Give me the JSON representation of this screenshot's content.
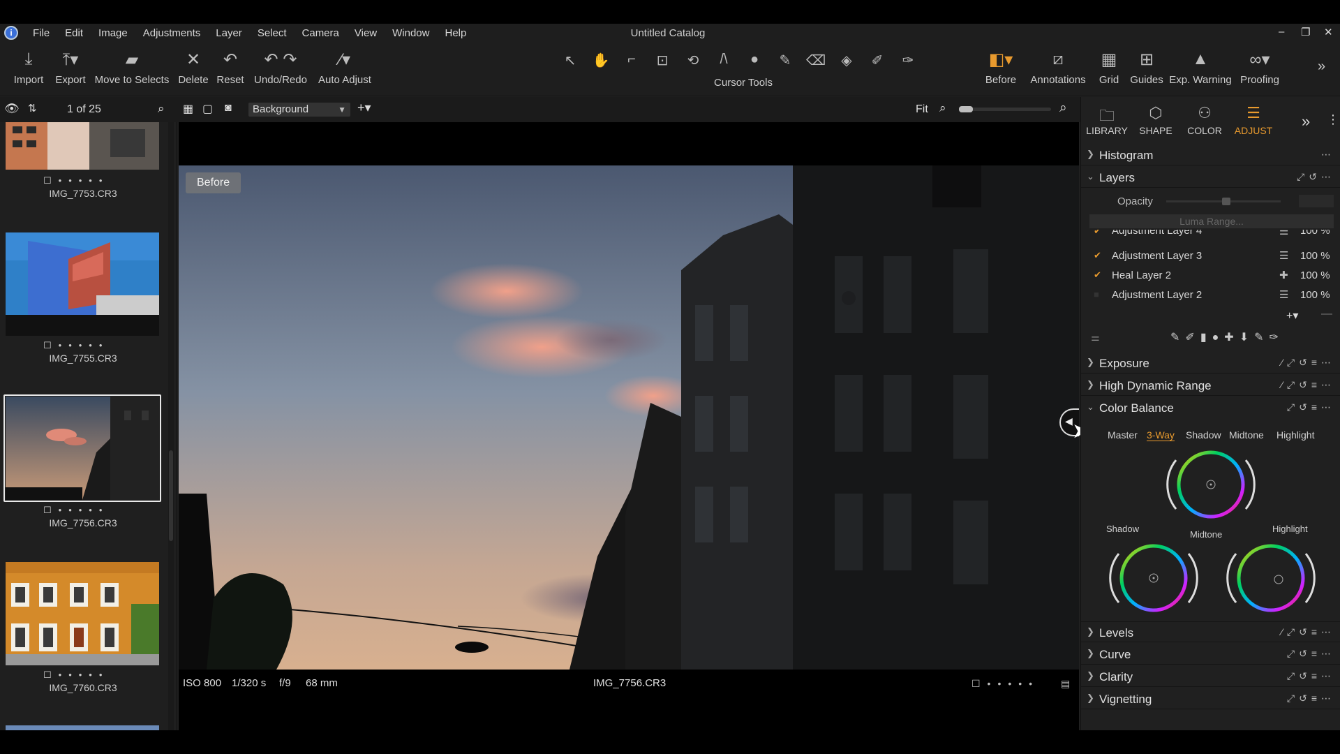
{
  "window": {
    "title": "Untitled Catalog"
  },
  "menu": [
    "File",
    "Edit",
    "Image",
    "Adjustments",
    "Layer",
    "Select",
    "Camera",
    "View",
    "Window",
    "Help"
  ],
  "toolbar": {
    "import": "Import",
    "export": "Export",
    "move_to_selects": "Move to Selects",
    "delete": "Delete",
    "reset": "Reset",
    "undo_redo": "Undo/Redo",
    "auto_adjust": "Auto Adjust",
    "cursor_tools": "Cursor Tools",
    "before": "Before",
    "annotations": "Annotations",
    "grid": "Grid",
    "guides": "Guides",
    "exp_warning": "Exp. Warning",
    "proofing": "Proofing"
  },
  "subbar": {
    "counter": "1 of 25",
    "variant": "Background",
    "fit": "Fit",
    "zoom_level": 0.1
  },
  "filmstrip": {
    "items": [
      {
        "name": "IMG_7753.CR3"
      },
      {
        "name": "IMG_7755.CR3"
      },
      {
        "name": "IMG_7756.CR3",
        "selected": true
      },
      {
        "name": "IMG_7760.CR3"
      }
    ]
  },
  "viewer": {
    "badge": "Before",
    "iso": "ISO 800",
    "shutter": "1/320 s",
    "aperture": "f/9",
    "focal": "68 mm",
    "filename": "IMG_7756.CR3"
  },
  "panel": {
    "tabs": [
      "LIBRARY",
      "SHAPE",
      "COLOR",
      "ADJUST"
    ],
    "active_tab": "ADJUST",
    "histogram": "Histogram",
    "layers": {
      "title": "Layers",
      "opacity_label": "Opacity",
      "luma_range": "Luma Range...",
      "rows": [
        {
          "name": "Adjustment Layer 4",
          "pct": "100 %",
          "checked": true
        },
        {
          "name": "Adjustment Layer 3",
          "pct": "100 %",
          "checked": true
        },
        {
          "name": "Heal Layer 2",
          "pct": "100 %",
          "checked": true
        },
        {
          "name": "Adjustment Layer 2",
          "pct": "100 %",
          "checked": false
        }
      ]
    },
    "exposure": "Exposure",
    "hdr": "High Dynamic Range",
    "color_balance": {
      "title": "Color Balance",
      "tabs": [
        "Master",
        "3-Way",
        "Shadow",
        "Midtone",
        "Highlight"
      ],
      "active": "3-Way",
      "labels": {
        "shadow": "Shadow",
        "midtone": "Midtone",
        "highlight": "Highlight"
      }
    },
    "levels": "Levels",
    "curve": "Curve",
    "clarity": "Clarity",
    "vignetting": "Vignetting"
  },
  "colors": {
    "accent": "#e89a2e",
    "panel_bg": "#202020"
  }
}
